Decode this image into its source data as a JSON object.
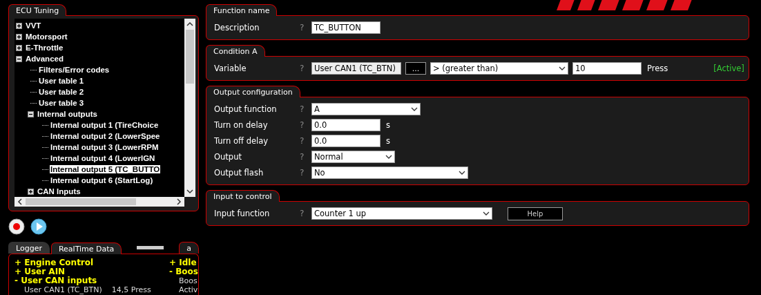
{
  "tree_panel": {
    "title": "ECU Tuning",
    "items": [
      {
        "label": "VVT",
        "kind": "folder",
        "expanded": false,
        "selected": false
      },
      {
        "label": "Motorsport",
        "kind": "folder",
        "expanded": false,
        "selected": false
      },
      {
        "label": "E-Throttle",
        "kind": "folder",
        "expanded": false,
        "selected": false
      },
      {
        "label": "Advanced",
        "kind": "folder",
        "expanded": true,
        "selected": false,
        "children": [
          {
            "label": "Filters/Error codes",
            "kind": "leaf",
            "selected": false
          },
          {
            "label": "User table 1",
            "kind": "leaf",
            "selected": false
          },
          {
            "label": "User table 2",
            "kind": "leaf",
            "selected": false
          },
          {
            "label": "User table 3",
            "kind": "leaf",
            "selected": false
          },
          {
            "label": "Internal outputs",
            "kind": "folder",
            "expanded": true,
            "selected": false,
            "children": [
              {
                "label": "Internal output 1 (TireChoice",
                "kind": "leaf",
                "selected": false
              },
              {
                "label": "Internal output 2 (LowerSpee",
                "kind": "leaf",
                "selected": false
              },
              {
                "label": "Internal output 3 (LowerRPM",
                "kind": "leaf",
                "selected": false
              },
              {
                "label": "Internal output 4 (LowerIGN",
                "kind": "leaf",
                "selected": false
              },
              {
                "label": "Internal output 5 (TC_BUTTO",
                "kind": "leaf",
                "selected": true
              },
              {
                "label": "Internal output 6 (StartLog)",
                "kind": "leaf",
                "selected": false
              }
            ]
          },
          {
            "label": "CAN Inputs",
            "kind": "folder",
            "expanded": false,
            "selected": false
          }
        ]
      }
    ]
  },
  "realtime_panel": {
    "tabs": [
      {
        "label": "Logger",
        "selected": false
      },
      {
        "label": "RealTime Data",
        "selected": true
      },
      {
        "label": "a",
        "selected": false
      }
    ],
    "column_1": [
      {
        "label": "+ Engine Control",
        "kind": "group"
      },
      {
        "label": "+ User AIN",
        "kind": "group"
      },
      {
        "label": "- User CAN inputs",
        "kind": "group"
      },
      {
        "label": "User CAN1 (TC_BTN)",
        "value": "14,5 Press",
        "kind": "value"
      }
    ],
    "column_2": [
      {
        "label": "+ Idle",
        "kind": "group"
      },
      {
        "label": "- Boos",
        "kind": "group"
      },
      {
        "label": "Boos",
        "kind": "value"
      },
      {
        "label": "Activ",
        "kind": "value"
      }
    ]
  },
  "sections": [
    {
      "title": "Function name",
      "rows": [
        {
          "label": "Description",
          "help": "?",
          "controls": [
            {
              "kind": "text",
              "value": "TC_BUTTON"
            }
          ]
        }
      ]
    },
    {
      "title": "Condition A",
      "rows": [
        {
          "label": "Variable",
          "help": "?",
          "controls": [
            {
              "kind": "readonly",
              "value": "User CAN1 (TC_BTN)"
            },
            {
              "kind": "button",
              "label": "..."
            },
            {
              "kind": "select",
              "value": "> (greater than)"
            },
            {
              "kind": "text",
              "value": "10"
            },
            {
              "kind": "unit",
              "label": "Press"
            },
            {
              "kind": "status",
              "label": "[Active]"
            }
          ]
        }
      ]
    },
    {
      "title": "Output configuration",
      "rows": [
        {
          "label": "Output function",
          "help": "?",
          "controls": [
            {
              "kind": "select",
              "value": "A"
            }
          ]
        },
        {
          "label": "Turn on delay",
          "help": "?",
          "controls": [
            {
              "kind": "text",
              "value": "0.0"
            },
            {
              "kind": "unit",
              "label": "s"
            }
          ]
        },
        {
          "label": "Turn off delay",
          "help": "?",
          "controls": [
            {
              "kind": "text",
              "value": "0.0"
            },
            {
              "kind": "unit",
              "label": "s"
            }
          ]
        },
        {
          "label": "Output",
          "help": "?",
          "controls": [
            {
              "kind": "select",
              "value": "Normal"
            }
          ]
        },
        {
          "label": "Output flash",
          "help": "?",
          "controls": [
            {
              "kind": "select",
              "value": "No"
            }
          ]
        }
      ]
    },
    {
      "title": "Input to control",
      "rows": [
        {
          "label": "Input function",
          "help": "?",
          "controls": [
            {
              "kind": "select",
              "value": "Counter 1 up"
            },
            {
              "kind": "button",
              "label": "Help"
            }
          ]
        }
      ]
    }
  ]
}
